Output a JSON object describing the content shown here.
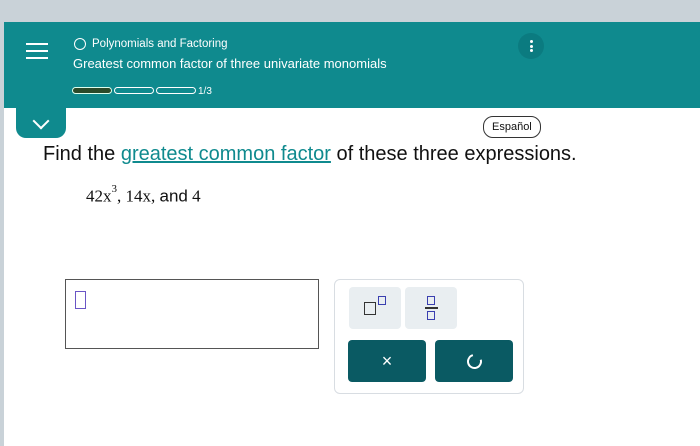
{
  "header": {
    "topic": "Polynomials and Factoring",
    "subtitle": "Greatest common factor of three univariate monomials",
    "progress_label": "1/3",
    "progress": {
      "completed": 1,
      "total": 3
    },
    "accent": "#0f8a8e"
  },
  "language_button": "Español",
  "question": {
    "prefix": "Find the ",
    "link": "greatest common factor",
    "suffix": " of these three expressions."
  },
  "expression": {
    "term1_base": "42x",
    "term1_exp": "3",
    "sep1": ", ",
    "term2": "14x",
    "sep2": ", ",
    "and_word": "and",
    "term3": "4"
  },
  "keypad": {
    "clear_label": "×",
    "icons": [
      "exponent-icon",
      "fraction-icon",
      "undo-icon"
    ],
    "dark_color": "#0a5a63"
  }
}
